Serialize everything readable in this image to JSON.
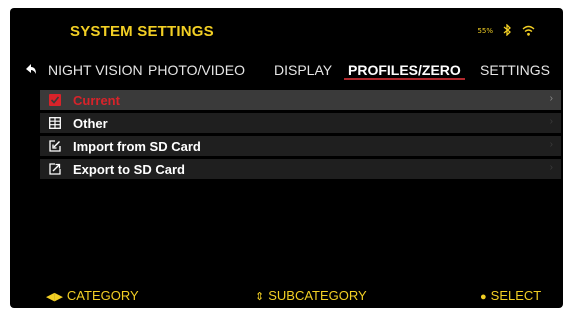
{
  "header": {
    "title": "SYSTEM SETTINGS",
    "battery": "55%"
  },
  "tabs": [
    {
      "label": "NIGHT VISION",
      "active": false
    },
    {
      "label": "PHOTO/VIDEO",
      "active": false
    },
    {
      "label": "DISPLAY",
      "active": false
    },
    {
      "label": "PROFILES/ZERO",
      "active": true
    },
    {
      "label": "SETTINGS",
      "active": false
    }
  ],
  "menu": {
    "items": [
      {
        "label": "Current",
        "icon": "checkbox-checked-icon",
        "selected": true
      },
      {
        "label": "Other",
        "icon": "grid-icon",
        "selected": false
      },
      {
        "label": "Import from SD Card",
        "icon": "import-icon",
        "selected": false
      },
      {
        "label": "Export to SD Card",
        "icon": "export-icon",
        "selected": false
      }
    ]
  },
  "footer": {
    "category": "CATEGORY",
    "subcategory": "SUBCATEGORY",
    "select": "SELECT"
  },
  "colors": {
    "accent": "#f2cf24",
    "selected_text": "#d8232a",
    "active_tab_underline": "#b0282d"
  }
}
